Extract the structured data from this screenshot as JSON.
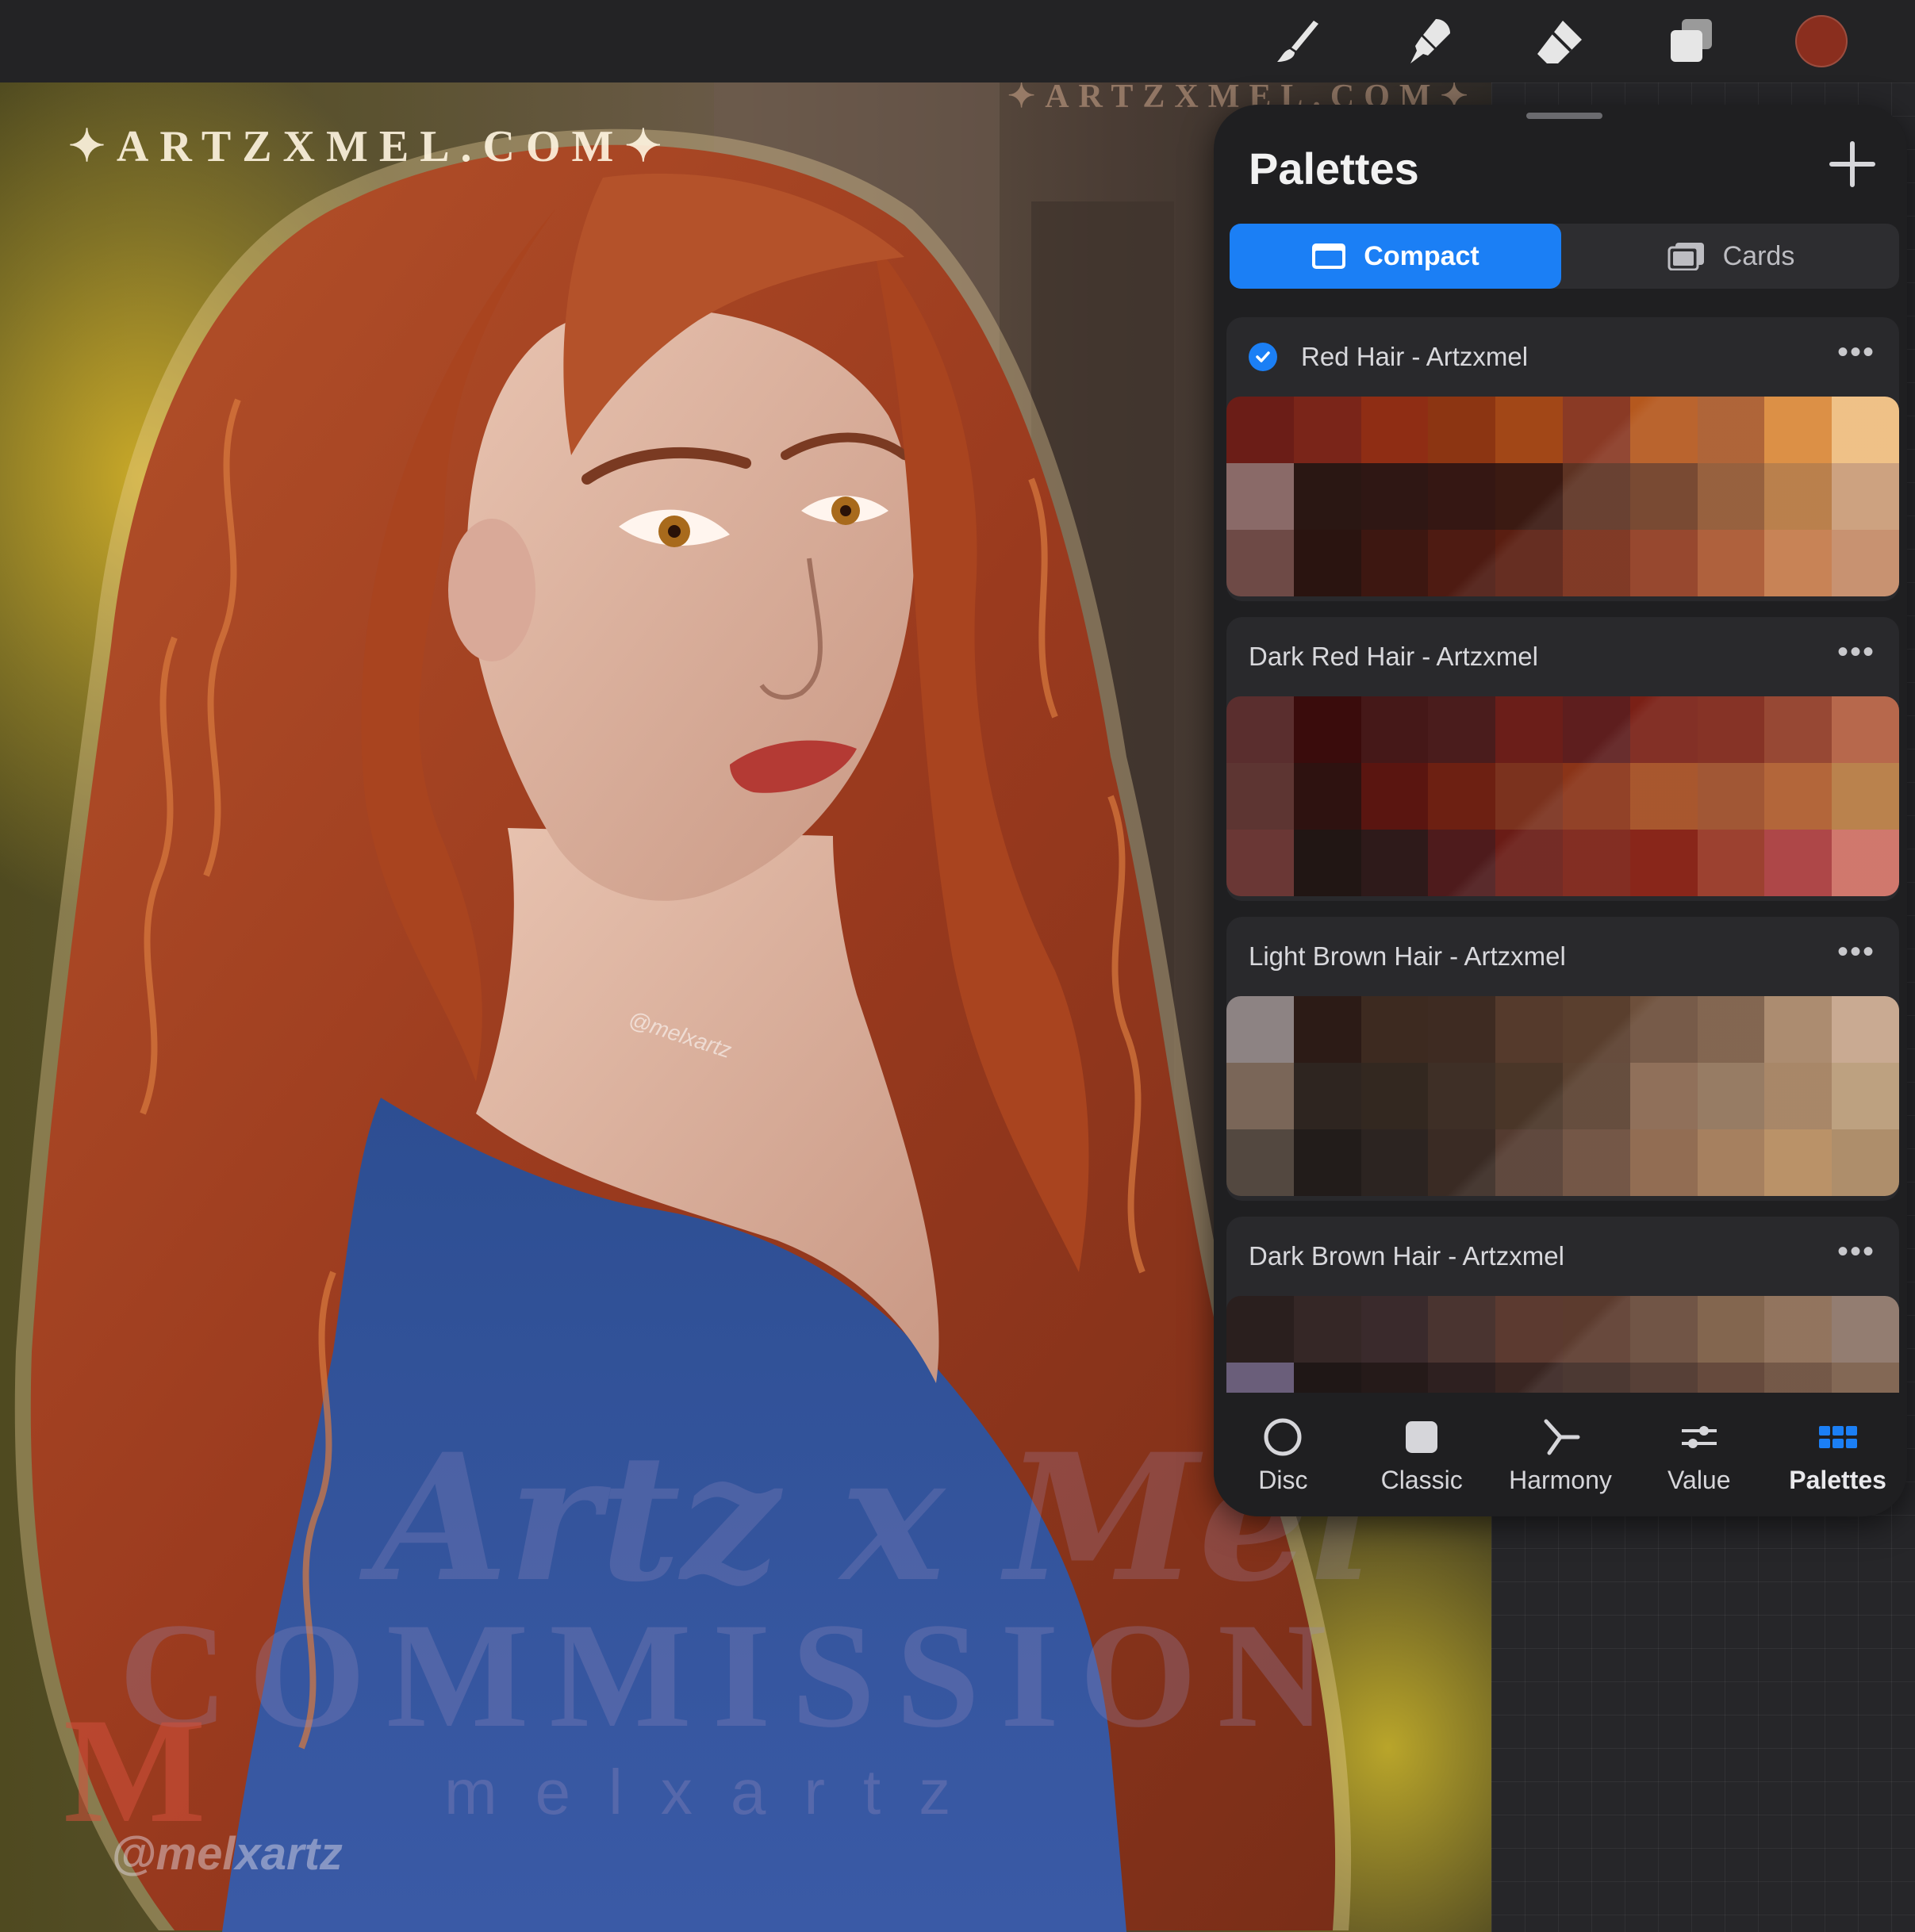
{
  "toolbar": {
    "tools": [
      "brush-icon",
      "smudge-icon",
      "eraser-icon",
      "layers-icon"
    ],
    "current_color": "#8a2e1e"
  },
  "canvas": {
    "watermark_top": "✦ARTZXMEL.COM✦",
    "watermark_top_right": "✦ARTZXMEL.COM✦",
    "watermark_script": "Artz x Mel",
    "watermark_commission": "COMMISSION",
    "watermark_melxartz": "melxartz",
    "watermark_handle": "@melxartz",
    "watermark_neck": "@melxartz",
    "watermark_logo": "M"
  },
  "panel": {
    "title": "Palettes",
    "add_icon": "plus-icon",
    "view_modes": [
      {
        "label": "Compact",
        "selected": true
      },
      {
        "label": "Cards",
        "selected": false
      }
    ],
    "palettes": [
      {
        "name": "Red Hair - Artzxmel",
        "is_default": true,
        "colors": [
          "#6b1d17",
          "#7a2519",
          "#8f2d14",
          "#8c3512",
          "#a24717",
          "#8a3a25",
          "#b5581e",
          "#a9592a",
          "#d98838",
          "#eebc7e",
          "#8a6a68",
          "#2a1713",
          "#2f1714",
          "#351713",
          "#3b1a12",
          "#5e3323",
          "#6f3c24",
          "#8f5530",
          "#b5763f",
          "#c99b76",
          "#6e4a46",
          "#2a1410",
          "#3d1711",
          "#4e1b12",
          "#5a1e11",
          "#772b16",
          "#8f3a1f",
          "#a9552e",
          "#c47a49",
          "#c48a66"
        ]
      },
      {
        "name": "Dark Red Hair - Artzxmel",
        "is_default": false,
        "colors": [
          "#5a2e2e",
          "#3a0c0c",
          "#451818",
          "#4a1c1c",
          "#6b1e19",
          "#5e1e1e",
          "#7a2016",
          "#7d2416",
          "#8f3a25",
          "#b25c3e",
          "#5d3532",
          "#2e1210",
          "#5a1510",
          "#6d2012",
          "#7b321e",
          "#8a3418",
          "#a24a1e",
          "#9a4a26",
          "#ad5a2b",
          "#b57840",
          "#6a3735",
          "#211614",
          "#2e1a1a",
          "#4e1b1c",
          "#6a1c16",
          "#7a1e12",
          "#801609",
          "#953320",
          "#a8393a",
          "#cd6e62"
        ]
      },
      {
        "name": "Light Brown Hair - Artzxmel",
        "is_default": false,
        "colors": [
          "#8d8383",
          "#2c1b16",
          "#3d2a20",
          "#3e2b22",
          "#553a2c",
          "#5a3f2e",
          "#6d4f3b",
          "#7a5b44",
          "#a68365",
          "#c5a48a",
          "#7a6658",
          "#2e2520",
          "#332820",
          "#3e2f26",
          "#4a3628",
          "#5a4130",
          "#88654e",
          "#8f7258",
          "#a27e5d",
          "#b89a76",
          "#534840",
          "#221c1a",
          "#2c2421",
          "#3a2b24",
          "#543b30",
          "#6a4a39",
          "#8a6246",
          "#9f7653",
          "#b58a5c",
          "#a88560"
        ]
      },
      {
        "name": "Dark Brown Hair - Artzxmel",
        "is_default": false,
        "colors": [
          "#2a1f1e",
          "#352726",
          "#3a2a2c",
          "#4a3430",
          "#5c3a30",
          "#5c3b2e",
          "#664838",
          "#7a5a42",
          "#8a6a52",
          "#8b7366",
          "#6a5e7a",
          "#1f1716",
          "#251a19",
          "#2e2020",
          "#3a2622",
          "#3e2a24",
          "#4a3228",
          "#5a3c2e",
          "#6a4c3a",
          "#7a5c48"
        ]
      }
    ]
  },
  "tabs": [
    {
      "label": "Disc",
      "icon": "disc-icon",
      "active": false
    },
    {
      "label": "Classic",
      "icon": "classic-icon",
      "active": false
    },
    {
      "label": "Harmony",
      "icon": "harmony-icon",
      "active": false
    },
    {
      "label": "Value",
      "icon": "value-icon",
      "active": false
    },
    {
      "label": "Palettes",
      "icon": "palettes-grid-icon",
      "active": true
    }
  ],
  "colors": {
    "accent": "#1b7ff5",
    "panel_bg": "#1f1f21"
  }
}
